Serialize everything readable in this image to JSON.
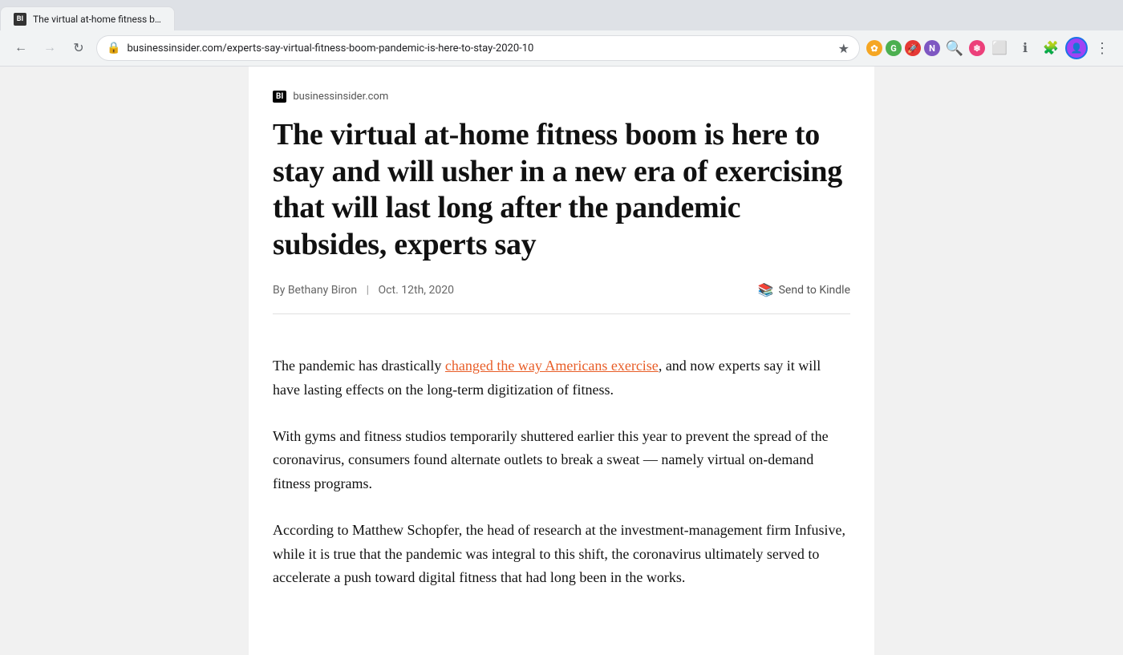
{
  "browser": {
    "tab_title": "The virtual at-home fitness boom is here to stay...",
    "url": "businessinsider.com/experts-say-virtual-fitness-boom-pandemic-is-here-to-stay-2020-10",
    "tab_favicon_text": "BI",
    "back_disabled": false,
    "forward_disabled": true,
    "toolbar_icons": [
      {
        "name": "sunflower-ext",
        "class": "ext-yellow",
        "label": "✿"
      },
      {
        "name": "grammarly-ext",
        "class": "ext-green",
        "label": "G"
      },
      {
        "name": "rocketreach-ext",
        "class": "ext-red",
        "label": "🚀"
      },
      {
        "name": "onenote-ext",
        "class": "ext-purple",
        "label": "N"
      },
      {
        "name": "search-ext",
        "class": "ext-gray",
        "label": "🔍"
      },
      {
        "name": "snowflake-ext",
        "class": "ext-pink",
        "label": "❄"
      },
      {
        "name": "screenshot-ext",
        "class": "ext-gray",
        "label": "⬜"
      },
      {
        "name": "info-ext",
        "class": "ext-gray",
        "label": "ℹ"
      },
      {
        "name": "puzzle-ext",
        "class": "ext-gray",
        "label": "🧩"
      }
    ]
  },
  "article": {
    "source_logo": "BI",
    "source_name": "businessinsider.com",
    "title": "The virtual at-home fitness boom is here to stay and will usher in a new era of exercising that will last long after the pandemic subsides, experts say",
    "author": "By Bethany Biron",
    "date": "Oct. 12th, 2020",
    "send_to_kindle_label": "Send to Kindle",
    "paragraphs": [
      {
        "id": "p1",
        "text_before": "The pandemic has drastically ",
        "link_text": "changed the way Americans exercise",
        "text_after": ", and now experts say it will have lasting effects on the long-term digitization of fitness."
      },
      {
        "id": "p2",
        "text": "With gyms and fitness studios temporarily shuttered earlier this year to prevent the spread of the coronavirus, consumers found alternate outlets to break a sweat — namely virtual on-demand fitness programs."
      },
      {
        "id": "p3",
        "text": "According to Matthew Schopfer, the head of research at the investment-management firm Infusive, while it is true that the pandemic was integral to this shift, the coronavirus ultimately served to accelerate a push toward digital fitness that had long been in the works."
      }
    ]
  }
}
